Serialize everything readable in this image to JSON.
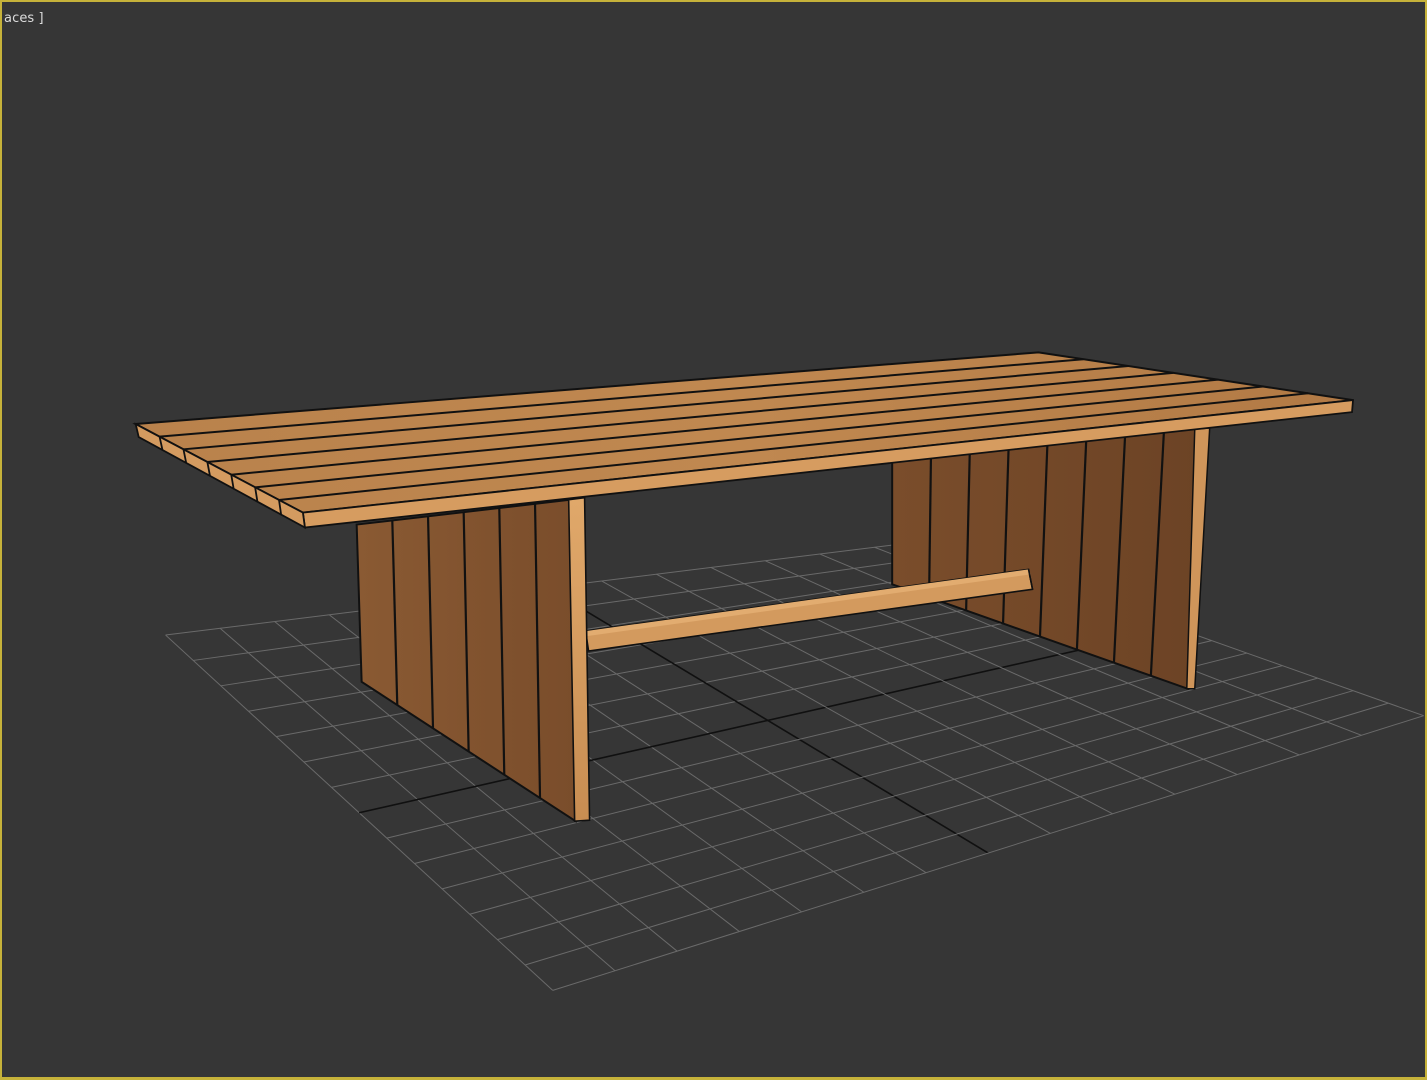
{
  "viewport": {
    "label": "aces ]",
    "active": true,
    "colors": {
      "background": "#363636",
      "border_active": "#c6b23a",
      "grid_line": "#6a6a6a",
      "grid_axis": "#101010",
      "wood_light": "#c58a52",
      "wood_mid": "#a36e3f",
      "wood_dark": "#6f4524",
      "edge": "#111111"
    }
  },
  "scene": {
    "object": "wooden-table",
    "grid": "home-grid",
    "top_planks": 7,
    "leg_planks": 6
  }
}
